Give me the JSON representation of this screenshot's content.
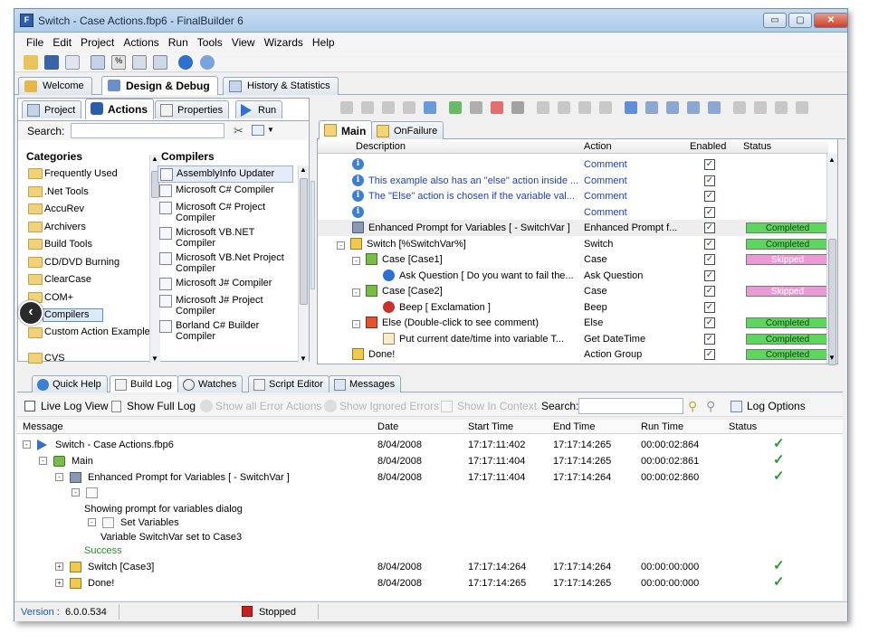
{
  "window": {
    "title": "Switch - Case Actions.fbp6 - FinalBuilder 6",
    "min": "▭",
    "max": "▢",
    "close": "✕"
  },
  "menu": [
    "File",
    "Edit",
    "Project",
    "Actions",
    "Run",
    "Tools",
    "View",
    "Wizards",
    "Help"
  ],
  "main_tabs": [
    {
      "label": "Welcome",
      "icon": "home-icon"
    },
    {
      "label": "Design & Debug",
      "icon": "design-icon",
      "active": true
    },
    {
      "label": "History & Statistics",
      "icon": "calendar-icon"
    }
  ],
  "left_tabs": [
    {
      "label": "Project",
      "icon": "project-icon"
    },
    {
      "label": "Actions",
      "icon": "actions-icon",
      "active": true
    },
    {
      "label": "Properties",
      "icon": "properties-icon"
    },
    {
      "label": "Run",
      "icon": "run-icon"
    }
  ],
  "search": {
    "label": "Search:",
    "value": ""
  },
  "categories": {
    "header": "Categories",
    "items": [
      "Frequently Used",
      ".Net Tools",
      "AccuRev",
      "Archivers",
      "Build Tools",
      "CD/DVD Burning",
      "ClearCase",
      "COM+",
      "Compilers",
      "Custom Action Examples",
      "CVS"
    ],
    "selected": "Compilers"
  },
  "compilers": {
    "header": "Compilers",
    "items": [
      "AssemblyInfo Updater",
      "Microsoft C# Compiler",
      "Microsoft C# Project Compiler",
      "Microsoft VB.NET Compiler",
      "Microsoft VB.Net Project Compiler",
      "Microsoft J# Compiler",
      "Microsoft J# Project Compiler",
      "Borland C# Builder Compiler"
    ],
    "selected": "AssemblyInfo Updater"
  },
  "action_tabs": [
    {
      "label": "Main",
      "active": true
    },
    {
      "label": "OnFailure"
    }
  ],
  "action_columns": [
    "Description",
    "Action",
    "Enabled",
    "Status"
  ],
  "actions": [
    {
      "desc": "",
      "action": "Comment",
      "enabled": true,
      "status": "",
      "indent": 0,
      "icon": "info",
      "blue": true
    },
    {
      "desc": "This example also has an \"else\" action inside ...",
      "action": "Comment",
      "enabled": true,
      "status": "",
      "indent": 0,
      "icon": "info",
      "blue": true
    },
    {
      "desc": "The \"Else\" action is chosen if the variable val...",
      "action": "Comment",
      "enabled": true,
      "status": "",
      "indent": 0,
      "icon": "info",
      "blue": true
    },
    {
      "desc": "",
      "action": "Comment",
      "enabled": true,
      "status": "",
      "indent": 0,
      "icon": "info",
      "blue": true
    },
    {
      "desc": "Enhanced Prompt for Variables [  - SwitchVar ]",
      "action": "Enhanced Prompt f...",
      "enabled": true,
      "status": "Completed",
      "indent": 0,
      "icon": "prompt"
    },
    {
      "desc": "Switch [%SwitchVar%]",
      "action": "Switch",
      "enabled": true,
      "status": "Completed",
      "indent": 0,
      "icon": "switch",
      "tree": "-"
    },
    {
      "desc": "Case [Case1]",
      "action": "Case",
      "enabled": true,
      "status": "Skipped",
      "indent": 1,
      "icon": "case",
      "tree": "-"
    },
    {
      "desc": "Ask Question [ Do you want to fail the...",
      "action": "Ask Question",
      "enabled": true,
      "status": "",
      "indent": 2,
      "icon": "question"
    },
    {
      "desc": "Case [Case2]",
      "action": "Case",
      "enabled": true,
      "status": "Skipped",
      "indent": 1,
      "icon": "case",
      "tree": "-"
    },
    {
      "desc": "Beep [ Exclamation ]",
      "action": "Beep",
      "enabled": true,
      "status": "",
      "indent": 2,
      "icon": "beep"
    },
    {
      "desc": "Else (Double-click to see comment)",
      "action": "Else",
      "enabled": true,
      "status": "Completed",
      "indent": 1,
      "icon": "else",
      "tree": "-"
    },
    {
      "desc": "Put current date/time into variable T...",
      "action": "Get DateTime",
      "enabled": true,
      "status": "Completed",
      "indent": 2,
      "icon": "datetime"
    },
    {
      "desc": "Done!",
      "action": "Action Group",
      "enabled": true,
      "status": "Completed",
      "indent": 0,
      "icon": "group"
    }
  ],
  "bottom_tabs": [
    "Quick Help",
    "Build Log",
    "Watches",
    "Script Editor",
    "Messages"
  ],
  "log_toolbar": {
    "live": "Live Log View",
    "full": "Show Full Log",
    "errors": "Show all Error Actions",
    "ignored": "Show Ignored Errors",
    "context": "Show In Context",
    "search": "Search:",
    "options": "Log Options"
  },
  "log_columns": [
    "Message",
    "Date",
    "Start Time",
    "End Time",
    "Run Time",
    "Status"
  ],
  "log": [
    {
      "msg": "Switch - Case Actions.fbp6",
      "date": "8/04/2008",
      "start": "17:17:11:402",
      "end": "17:17:14:265",
      "run": "00:00:02:864",
      "ok": true,
      "indent": 0,
      "tree": "-",
      "icon": "run"
    },
    {
      "msg": "Main",
      "date": "8/04/2008",
      "start": "17:17:11:404",
      "end": "17:17:14:265",
      "run": "00:00:02:861",
      "ok": true,
      "indent": 1,
      "tree": "-",
      "icon": "main"
    },
    {
      "msg": "Enhanced Prompt for Variables [  - SwitchVar ]",
      "date": "8/04/2008",
      "start": "17:17:11:404",
      "end": "17:17:14:264",
      "run": "00:00:02:860",
      "ok": true,
      "indent": 2,
      "tree": "-",
      "icon": "prompt"
    },
    {
      "msg": "",
      "date": "",
      "start": "",
      "end": "",
      "run": "",
      "ok": false,
      "indent": 3,
      "tree": "-",
      "icon": "doc"
    },
    {
      "msg": "Showing prompt for variables dialog",
      "date": "",
      "start": "",
      "end": "",
      "run": "",
      "ok": false,
      "indent": 4
    },
    {
      "msg": "Set Variables",
      "date": "",
      "start": "",
      "end": "",
      "run": "",
      "ok": false,
      "indent": 4,
      "tree": "-",
      "icon": "doc"
    },
    {
      "msg": "Variable SwitchVar set to Case3",
      "date": "",
      "start": "",
      "end": "",
      "run": "",
      "ok": false,
      "indent": 5
    },
    {
      "msg": "Success",
      "date": "",
      "start": "",
      "end": "",
      "run": "",
      "ok": false,
      "indent": 4,
      "green": true
    },
    {
      "msg": "Switch [Case3]",
      "date": "8/04/2008",
      "start": "17:17:14:264",
      "end": "17:17:14:264",
      "run": "00:00:00:000",
      "ok": true,
      "indent": 2,
      "tree": "+",
      "icon": "switch"
    },
    {
      "msg": "Done!",
      "date": "8/04/2008",
      "start": "17:17:14:265",
      "end": "17:17:14:265",
      "run": "00:00:00:000",
      "ok": true,
      "indent": 2,
      "tree": "+",
      "icon": "group"
    }
  ],
  "status": {
    "version_label": "Version :",
    "version": "6.0.0.534",
    "state": "Stopped"
  },
  "colors": {
    "completed": "#5cd65c",
    "skipped": "#ec9ad6",
    "accent": "#2b5ea8"
  }
}
